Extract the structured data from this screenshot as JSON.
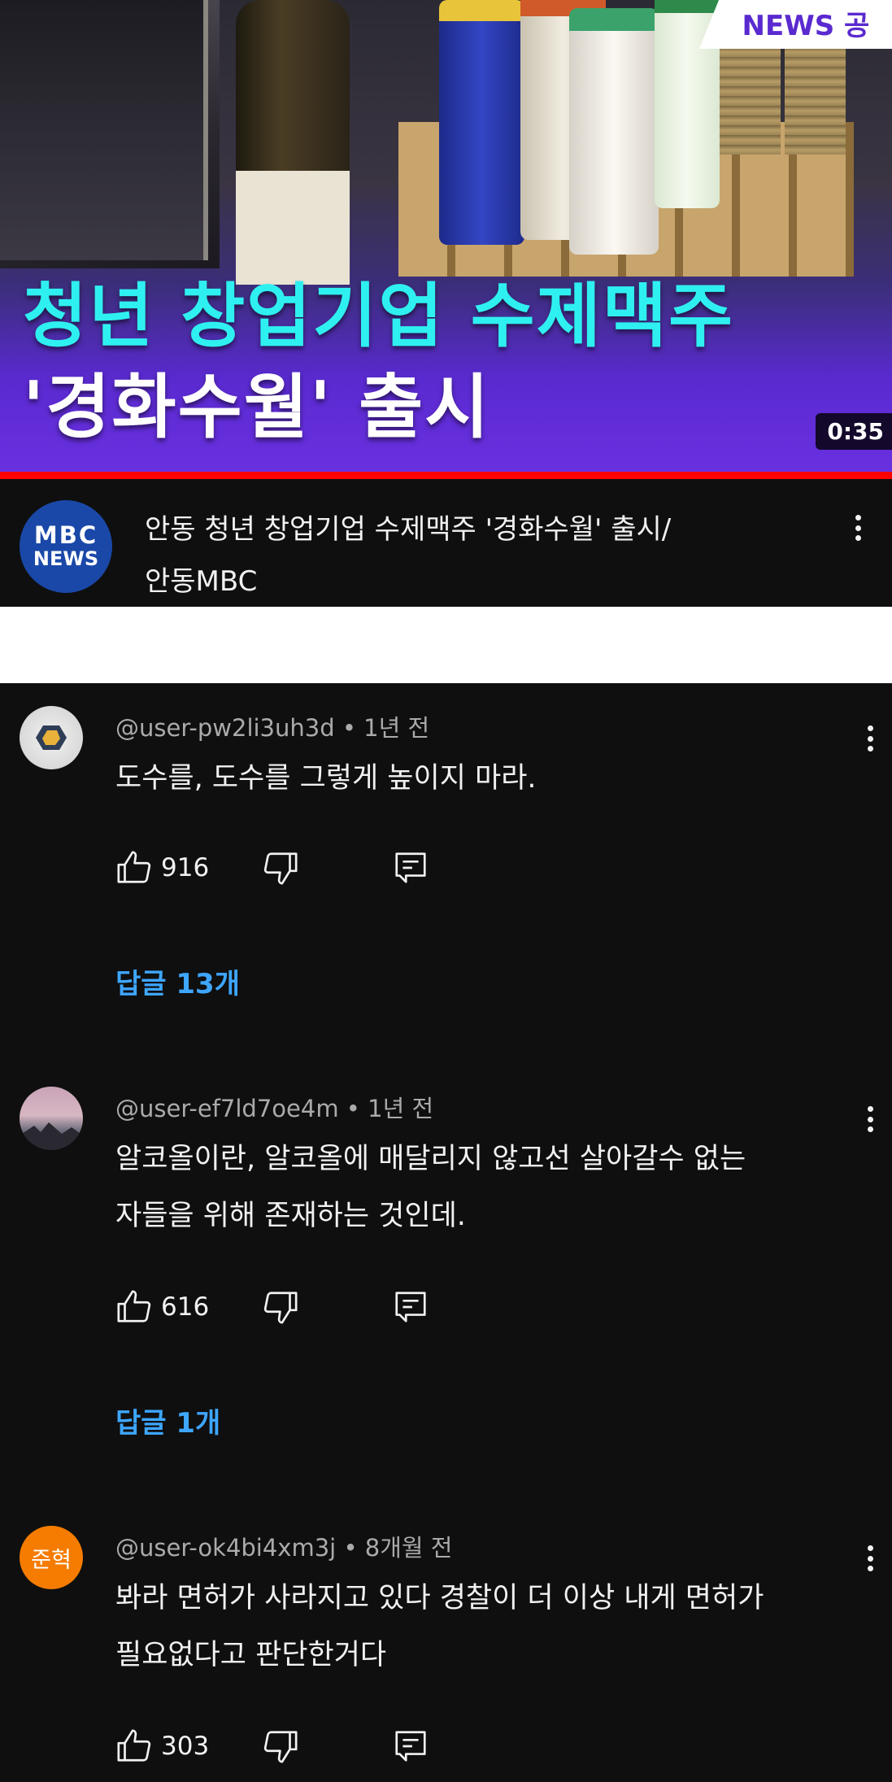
{
  "video": {
    "headline_line1": "청년 창업기업 수제맥주",
    "headline_line2": "'경화수월' 출시",
    "news_badge": "NEWS 공",
    "duration": "0:35",
    "title_line1": "안동 청년 창업기업 수제맥주 '경화수월' 출시/",
    "title_line2": "안동MBC",
    "channel_logo_top": "MBC",
    "channel_logo_bottom": "NEWS",
    "progress_color": "#ff0000",
    "accent_color": "#5a2ad0",
    "headline_color": "#2ff0f0"
  },
  "comments": [
    {
      "author": "@user-pw2li3uh3d",
      "age": "1년 전",
      "lines": [
        "도수를, 도수를 그렇게 높이지 마라."
      ],
      "likes": "916",
      "replies": "답글 13개",
      "avatar": "hexagon-image-avatar"
    },
    {
      "author": "@user-ef7ld7oe4m",
      "age": "1년 전",
      "lines": [
        "알코올이란, 알코올에 매달리지 않고선 살아갈수 없는",
        "자들을 위해 존재하는 것인데."
      ],
      "likes": "616",
      "replies": "답글 1개",
      "avatar": "landscape-image-avatar"
    },
    {
      "author": "@user-ok4bi4xm3j",
      "age": "8개월 전",
      "lines": [
        "봐라 면허가 사라지고 있다 경찰이 더 이상 내게 면허가",
        "필요없다고 판단한거다"
      ],
      "likes": "303",
      "avatar_text": "준혁",
      "avatar_color": "#f57c00"
    }
  ],
  "separator": "•",
  "link_color": "#3ea6ff"
}
